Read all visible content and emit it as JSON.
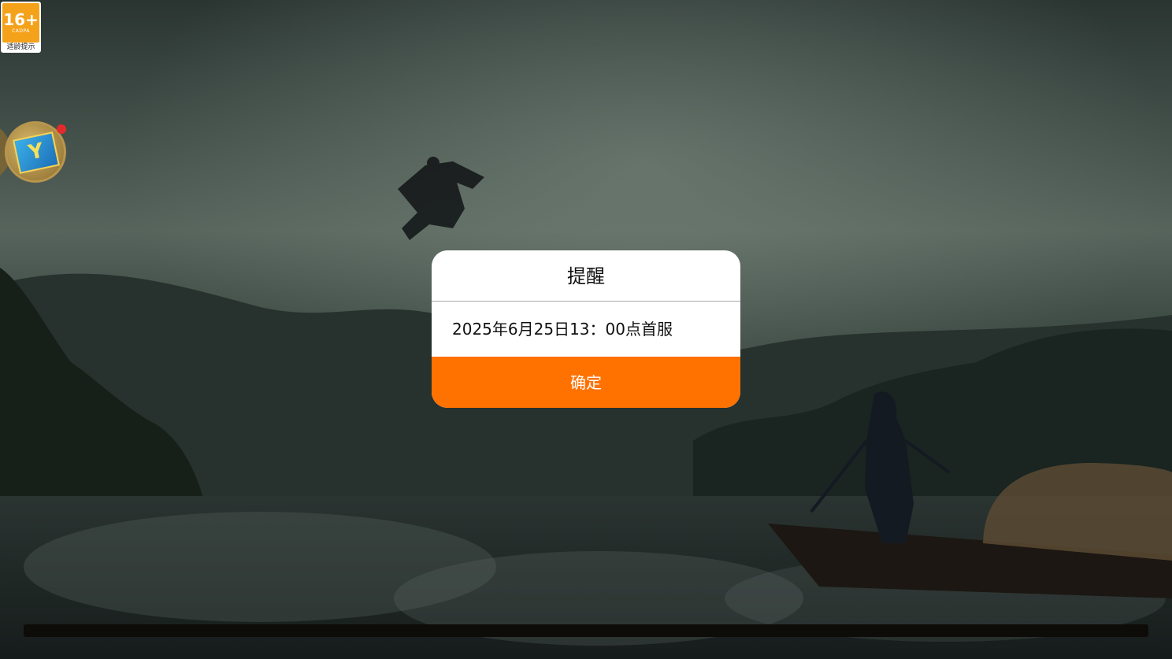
{
  "age_badge": {
    "rating": "16+",
    "org": "CADPA",
    "tip": "适龄提示"
  },
  "float_button": {
    "logo_letter": "Y",
    "icon": "float-logo-icon",
    "has_notification": true
  },
  "dialog": {
    "title": "提醒",
    "message": "2025年6月25日13：00点首服",
    "confirm_label": "确定",
    "accent_color": "#ff7200"
  }
}
